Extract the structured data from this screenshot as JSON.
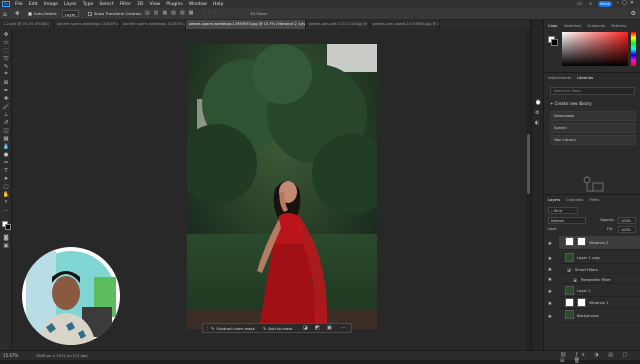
{
  "menu": [
    "File",
    "Edit",
    "Image",
    "Layer",
    "Type",
    "Select",
    "Filter",
    "3D",
    "View",
    "Plugins",
    "Window",
    "Help"
  ],
  "share_label": "Share",
  "options": {
    "auto_select_label": "Auto-Select:",
    "target_value": "Layer",
    "transform_label": "Show Transform Controls"
  },
  "tabs": [
    {
      "label": "1-2.psd @ 26.2% (RGB/8)",
      "active": false
    },
    {
      "label": "paneth sparrs weddings 1135491.jpg @ 12.5% (RGB/8)",
      "active": false
    },
    {
      "label": "paneth sparrs weddings 1135491.jpg @ 12.5% (RGB/8)",
      "active": false
    },
    {
      "label": "pexels-sparrs-weddings-17654974.jpg @ 15.7% (Vibrance 2, Layer Mask/8) *",
      "active": true
    },
    {
      "label": "pexels-ajay-pdf-11211318.jpg @ 16.6% (RGB/8)",
      "active": false
    },
    {
      "label": "pexels-sam-xawal-14158958.jpg @ 16.5% (RGB/8)",
      "active": false
    }
  ],
  "mask_bar": {
    "subtract_label": "Subtract from mask",
    "add_label": "Add to mask",
    "more_label": "..."
  },
  "status": {
    "zoom": "15.67%",
    "doc": "3648 px x 5472 px (72 ppi)"
  },
  "color_panel": {
    "tabs": [
      "Color",
      "Swatches",
      "Gradients",
      "Patterns"
    ]
  },
  "libraries_panel": {
    "tabs": [
      "Adjustments",
      "Libraries"
    ],
    "search_placeholder": "Search in Stock",
    "create_label": "Create new library",
    "items": [
      "Downloads",
      "Sparsh",
      "Your Library"
    ]
  },
  "layers_panel": {
    "tabs": [
      "Layers",
      "Channels",
      "Paths"
    ],
    "kind_label": "Kind",
    "blend_mode": "Normal",
    "opacity_label": "Opacity:",
    "opacity_value": "100%",
    "lock_label": "Lock:",
    "fill_label": "Fill:",
    "fill_value": "100%",
    "layers": [
      {
        "name": "Vibrance 2",
        "selected": true
      },
      {
        "name": "Layer 1 copy",
        "selected": false
      },
      {
        "name": "Smart Filters",
        "selected": false
      },
      {
        "name": "Parametric Filter",
        "selected": false
      },
      {
        "name": "Layer 1",
        "selected": false
      },
      {
        "name": "Vibrance 1",
        "selected": false
      },
      {
        "name": "Background",
        "selected": false
      }
    ]
  },
  "colors": {
    "accent": "#1473e6",
    "dress_red": "#a01015",
    "foliage": "#2c4a2a"
  }
}
